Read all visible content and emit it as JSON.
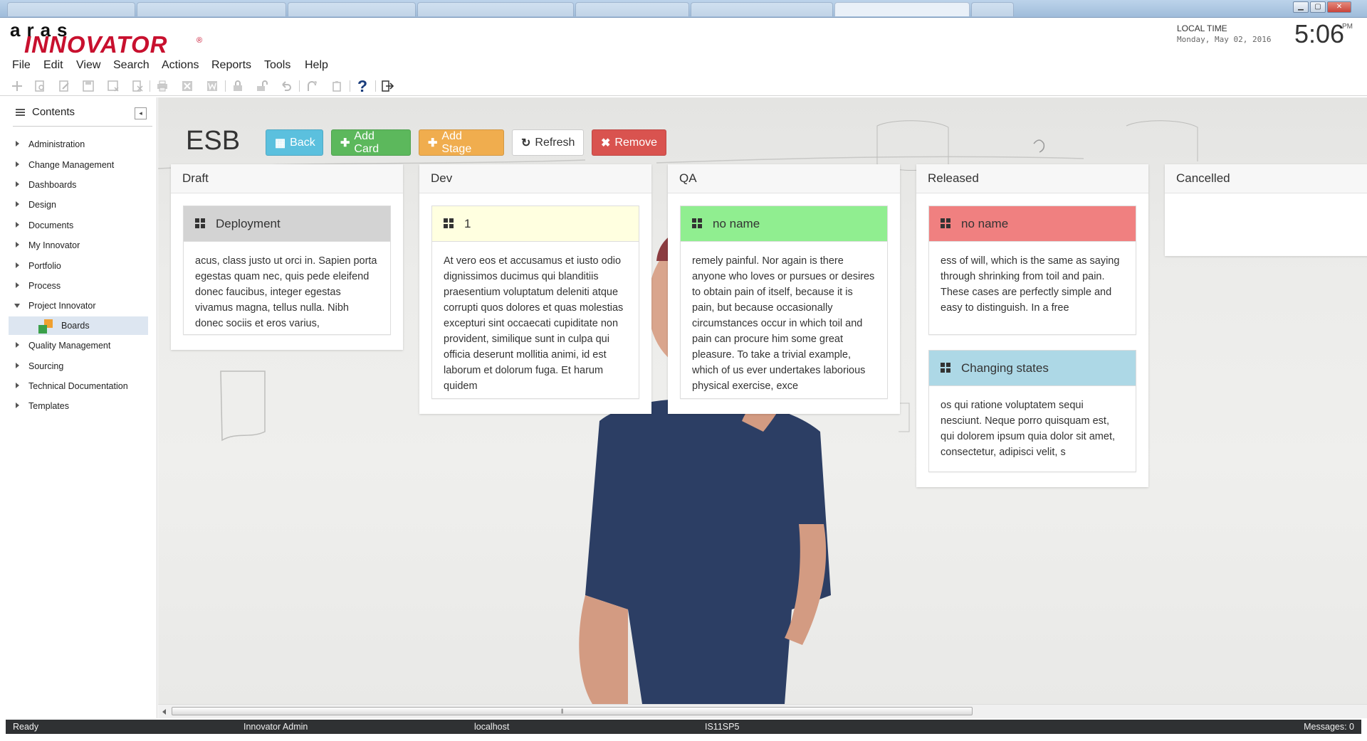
{
  "window": {
    "minimize_glyph": "▁",
    "maximize_glyph": "▢",
    "close_glyph": "✕"
  },
  "header": {
    "logo_top": "aras",
    "logo_main": "INNOVATOR",
    "logo_reg": "®",
    "local_time_label": "LOCAL TIME",
    "date": "Monday, May 02, 2016",
    "time": "5:06",
    "ampm": "PM"
  },
  "menu": [
    "File",
    "Edit",
    "View",
    "Search",
    "Actions",
    "Reports",
    "Tools",
    "Help"
  ],
  "toolbar": {
    "icons": [
      "new-icon",
      "open-icon",
      "edit-icon",
      "save-icon",
      "save-close-icon",
      "discard-icon",
      "print-icon",
      "excel-icon",
      "word-icon",
      "lock-icon",
      "unlock-icon",
      "undo-icon",
      "promote-icon",
      "copy-icon",
      "help-icon",
      "logout-icon"
    ],
    "help_glyph": "?"
  },
  "sidebar": {
    "title": "Contents",
    "collapse_glyph": "◂",
    "items": [
      {
        "label": "Administration"
      },
      {
        "label": "Change Management"
      },
      {
        "label": "Dashboards"
      },
      {
        "label": "Design"
      },
      {
        "label": "Documents"
      },
      {
        "label": "My Innovator"
      },
      {
        "label": "Portfolio"
      },
      {
        "label": "Process"
      },
      {
        "label": "Project Innovator"
      },
      {
        "label": "Quality Management"
      },
      {
        "label": "Sourcing"
      },
      {
        "label": "Technical Documentation"
      },
      {
        "label": "Templates"
      }
    ],
    "child": {
      "label": "Boards"
    },
    "colors": {
      "selected_bg": "#dde6f1"
    }
  },
  "board": {
    "title": "ESB",
    "buttons": {
      "back": {
        "icon": "▦",
        "label": "Back"
      },
      "add_card": {
        "icon": "✚",
        "label": "Add Card"
      },
      "add_stage": {
        "icon": "✚",
        "label": "Add Stage"
      },
      "refresh": {
        "icon": "↻",
        "label": "Refresh"
      },
      "remove": {
        "icon": "✖",
        "label": "Remove"
      }
    },
    "stages": [
      {
        "name": "Draft",
        "cards": [
          {
            "title": "Deployment",
            "color": "#d3d3d3",
            "text": "acus, class justo ut orci in. Sapien porta egestas quam nec, quis pede eleifend donec faucibus, integer egestas vivamus magna, tellus nulla. Nibh donec sociis et eros varius,"
          }
        ]
      },
      {
        "name": "Dev",
        "cards": [
          {
            "title": "1",
            "color": "#ffffe0",
            "text": "At vero eos et accusamus et iusto odio dignissimos ducimus qui blanditiis praesentium voluptatum deleniti atque corrupti quos dolores et quas molestias excepturi sint occaecati cupiditate non provident, similique sunt in culpa qui officia deserunt mollitia animi, id est laborum et dolorum fuga. Et harum quidem"
          }
        ]
      },
      {
        "name": "QA",
        "cards": [
          {
            "title": "no name",
            "color": "#90ee90",
            "text": "remely painful. Nor again is there anyone who loves or pursues or desires to obtain pain of itself, because it is pain, but because occasionally circumstances occur in which toil and pain can procure him some great pleasure. To take a trivial example, which of us ever undertakes laborious physical exercise, exce"
          }
        ]
      },
      {
        "name": "Released",
        "cards": [
          {
            "title": "no name",
            "color": "#f08080",
            "text": "ess of will, which is the same as saying through shrinking from toil and pain. These cases are perfectly simple and easy to distinguish. In a free"
          },
          {
            "title": "Changing states",
            "color": "#add8e6",
            "text": "os qui ratione voluptatem sequi nesciunt. Neque porro quisquam est, qui dolorem ipsum quia dolor sit amet, consectetur, adipisci velit, s"
          }
        ]
      },
      {
        "name": "Cancelled",
        "cards": []
      }
    ]
  },
  "status": {
    "state": "Ready",
    "user": "Innovator Admin",
    "server": "localhost",
    "database": "IS11SP5",
    "messages": "Messages: 0"
  }
}
